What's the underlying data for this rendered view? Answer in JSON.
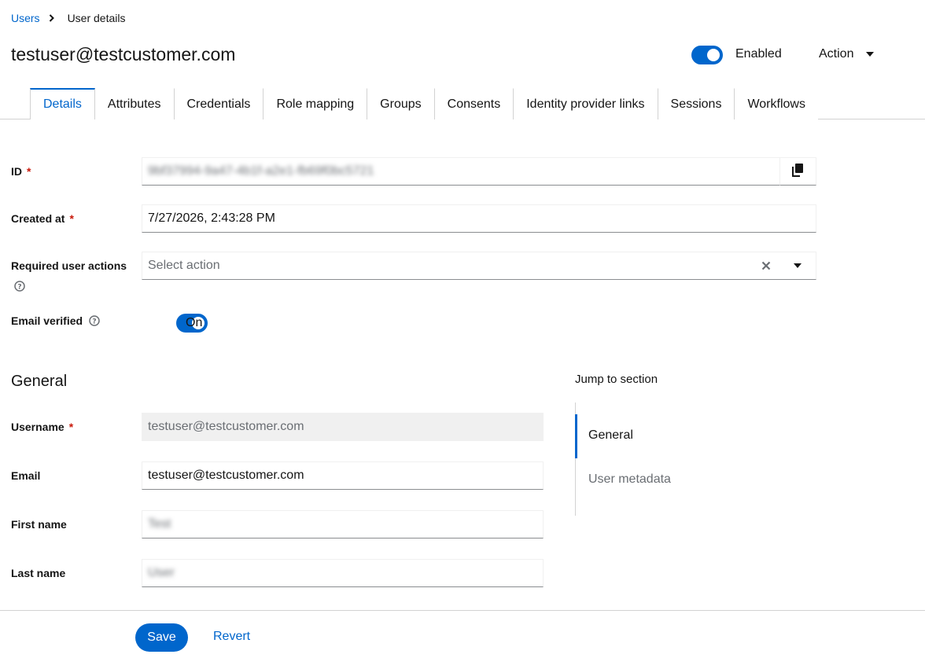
{
  "breadcrumb": {
    "parent": "Users",
    "current": "User details"
  },
  "header": {
    "title": "testuser@testcustomer.com",
    "enabled_label": "Enabled",
    "enabled": true,
    "action_label": "Action"
  },
  "tabs": [
    {
      "label": "Details",
      "active": true
    },
    {
      "label": "Attributes"
    },
    {
      "label": "Credentials"
    },
    {
      "label": "Role mapping"
    },
    {
      "label": "Groups"
    },
    {
      "label": "Consents"
    },
    {
      "label": "Identity provider links"
    },
    {
      "label": "Sessions"
    },
    {
      "label": "Workflows"
    }
  ],
  "form": {
    "id_label": "ID",
    "id_value": "9bf37994-9a47-4b1f-a2e1-fb69f0bc5721",
    "created_label": "Created at",
    "created_value": "7/27/2026, 2:43:28 PM",
    "required_actions_label": "Required user actions",
    "required_actions_placeholder": "Select action",
    "email_verified_label": "Email verified",
    "email_verified_state": "On",
    "required_marker": "*"
  },
  "general": {
    "title": "General",
    "username_label": "Username",
    "username_value": "testuser@testcustomer.com",
    "email_label": "Email",
    "email_value": "testuser@testcustomer.com",
    "first_name_label": "First name",
    "first_name_value": "Test",
    "last_name_label": "Last name",
    "last_name_value": "User"
  },
  "jump": {
    "title": "Jump to section",
    "items": [
      "General",
      "User metadata"
    ]
  },
  "footer": {
    "save_label": "Save",
    "revert_label": "Revert"
  },
  "colors": {
    "accent": "#0066cc",
    "required": "#c9190b"
  }
}
